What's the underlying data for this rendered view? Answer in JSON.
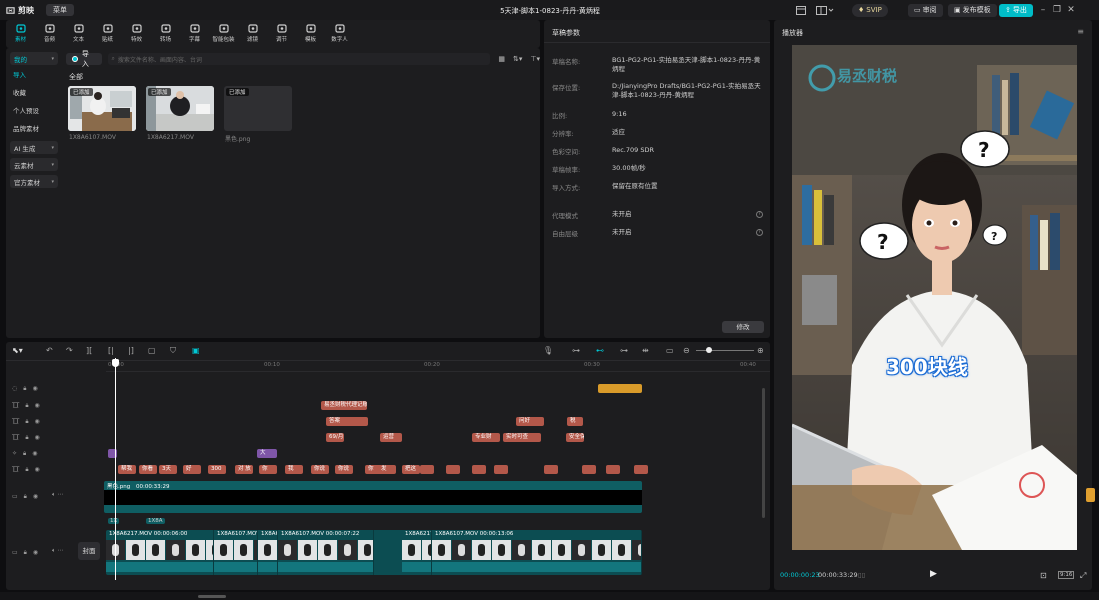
{
  "app": {
    "name": "剪映",
    "menu_label": "菜单",
    "project_title": "5天津-脚本1-0823-丹丹-黄炳程"
  },
  "header": {
    "svip": "SVIP",
    "review": "审阅",
    "publish_template": "发布模板",
    "export": "导出"
  },
  "toolbar": {
    "items": [
      {
        "label": "素材",
        "icon": "media-icon",
        "active": true
      },
      {
        "label": "音频",
        "icon": "audio-icon"
      },
      {
        "label": "文本",
        "icon": "text-icon"
      },
      {
        "label": "贴纸",
        "icon": "sticker-icon"
      },
      {
        "label": "特效",
        "icon": "effects-icon"
      },
      {
        "label": "转场",
        "icon": "transition-icon"
      },
      {
        "label": "字幕",
        "icon": "caption-icon"
      },
      {
        "label": "智能包装",
        "icon": "smart-pack-icon"
      },
      {
        "label": "滤镜",
        "icon": "filter-icon"
      },
      {
        "label": "调节",
        "icon": "adjust-icon"
      },
      {
        "label": "模板",
        "icon": "template-icon"
      },
      {
        "label": "数字人",
        "icon": "digital-human-icon"
      }
    ]
  },
  "sidebar": {
    "groups": [
      {
        "label": "我的",
        "type": "group"
      },
      {
        "label": "导入",
        "type": "item",
        "active": true
      },
      {
        "label": "收藏",
        "type": "item"
      },
      {
        "label": "个人预设",
        "type": "item"
      },
      {
        "label": "品牌素材",
        "type": "item"
      },
      {
        "label": "AI 生成",
        "type": "group"
      },
      {
        "label": "云素材",
        "type": "group"
      },
      {
        "label": "官方素材",
        "type": "group"
      }
    ]
  },
  "media": {
    "import_label": "导入",
    "search_placeholder": "搜索文件名称、画面内容、台词",
    "section_label": "全部",
    "items": [
      {
        "badge": "已添加",
        "name": "1X8A6107.MOV"
      },
      {
        "badge": "已添加",
        "name": "1X8A6217.MOV"
      },
      {
        "badge": "已添加",
        "name": "黑色.png"
      }
    ]
  },
  "props": {
    "title": "草稿参数",
    "rows": [
      {
        "label": "草稿名称:",
        "value": "BG1-PG2-PG1-实拍易丞天津-脚本1-0823-丹丹-黄炳程"
      },
      {
        "label": "保存位置:",
        "value": "D:/JianyingPro Drafts/BG1-PG2-PG1-实拍易丞天津-脚本1-0823-丹丹-黄炳程"
      },
      {
        "label": "比例:",
        "value": "9:16"
      },
      {
        "label": "分辨率:",
        "value": "适应"
      },
      {
        "label": "色彩空间:",
        "value": "Rec.709 SDR"
      },
      {
        "label": "草稿帧率:",
        "value": "30.00帧/秒"
      },
      {
        "label": "导入方式:",
        "value": "保留在原有位置"
      },
      {
        "label": "代理模式",
        "value": "未开启"
      },
      {
        "label": "自由层级",
        "value": "未开启"
      }
    ],
    "modify_label": "修改"
  },
  "player": {
    "title": "播放器",
    "overlay_text": "300块线",
    "watermark": "易丞财税",
    "current_time": "00:00:00:23",
    "total_time": "00:00:33:29",
    "ratio_label": "9:16"
  },
  "timeline": {
    "ruler_ticks": [
      "00:00",
      "00:10",
      "00:20",
      "00:30",
      "00:40"
    ],
    "text_clips_row1": [
      "易丞财税代理记账"
    ],
    "text_clips_row2": [
      "答案",
      "问好",
      "税"
    ],
    "text_clips_row3": [
      "69/月",
      "运营",
      "专业财",
      "实时可查",
      "安全保"
    ],
    "effect_clips": [
      "大"
    ],
    "caption_clips": [
      "帮我",
      "你看",
      "3天",
      "好",
      "300",
      "对 放",
      "你",
      "我",
      "你说",
      "你说",
      "你",
      "发",
      "把这"
    ],
    "overlay_track": {
      "name": "黑色.png",
      "duration": "00:00:33:29"
    },
    "main_track": {
      "cover_label": "封面",
      "clips": [
        {
          "name": "1X8A6217.MOV",
          "duration": "00:00:06:00"
        },
        {
          "name": "1X8A6107.MOV",
          "duration": ""
        },
        {
          "name": "1X8A6",
          "duration": ""
        },
        {
          "name": "1X8A6107.MOV",
          "duration": "00:00:07:22"
        },
        {
          "name": "1X8A6217.",
          "duration": ""
        },
        {
          "name": "1X8A6107.MOV",
          "duration": "00:00:13:06"
        }
      ],
      "small_labels": [
        "1X",
        "1X8A"
      ]
    }
  }
}
